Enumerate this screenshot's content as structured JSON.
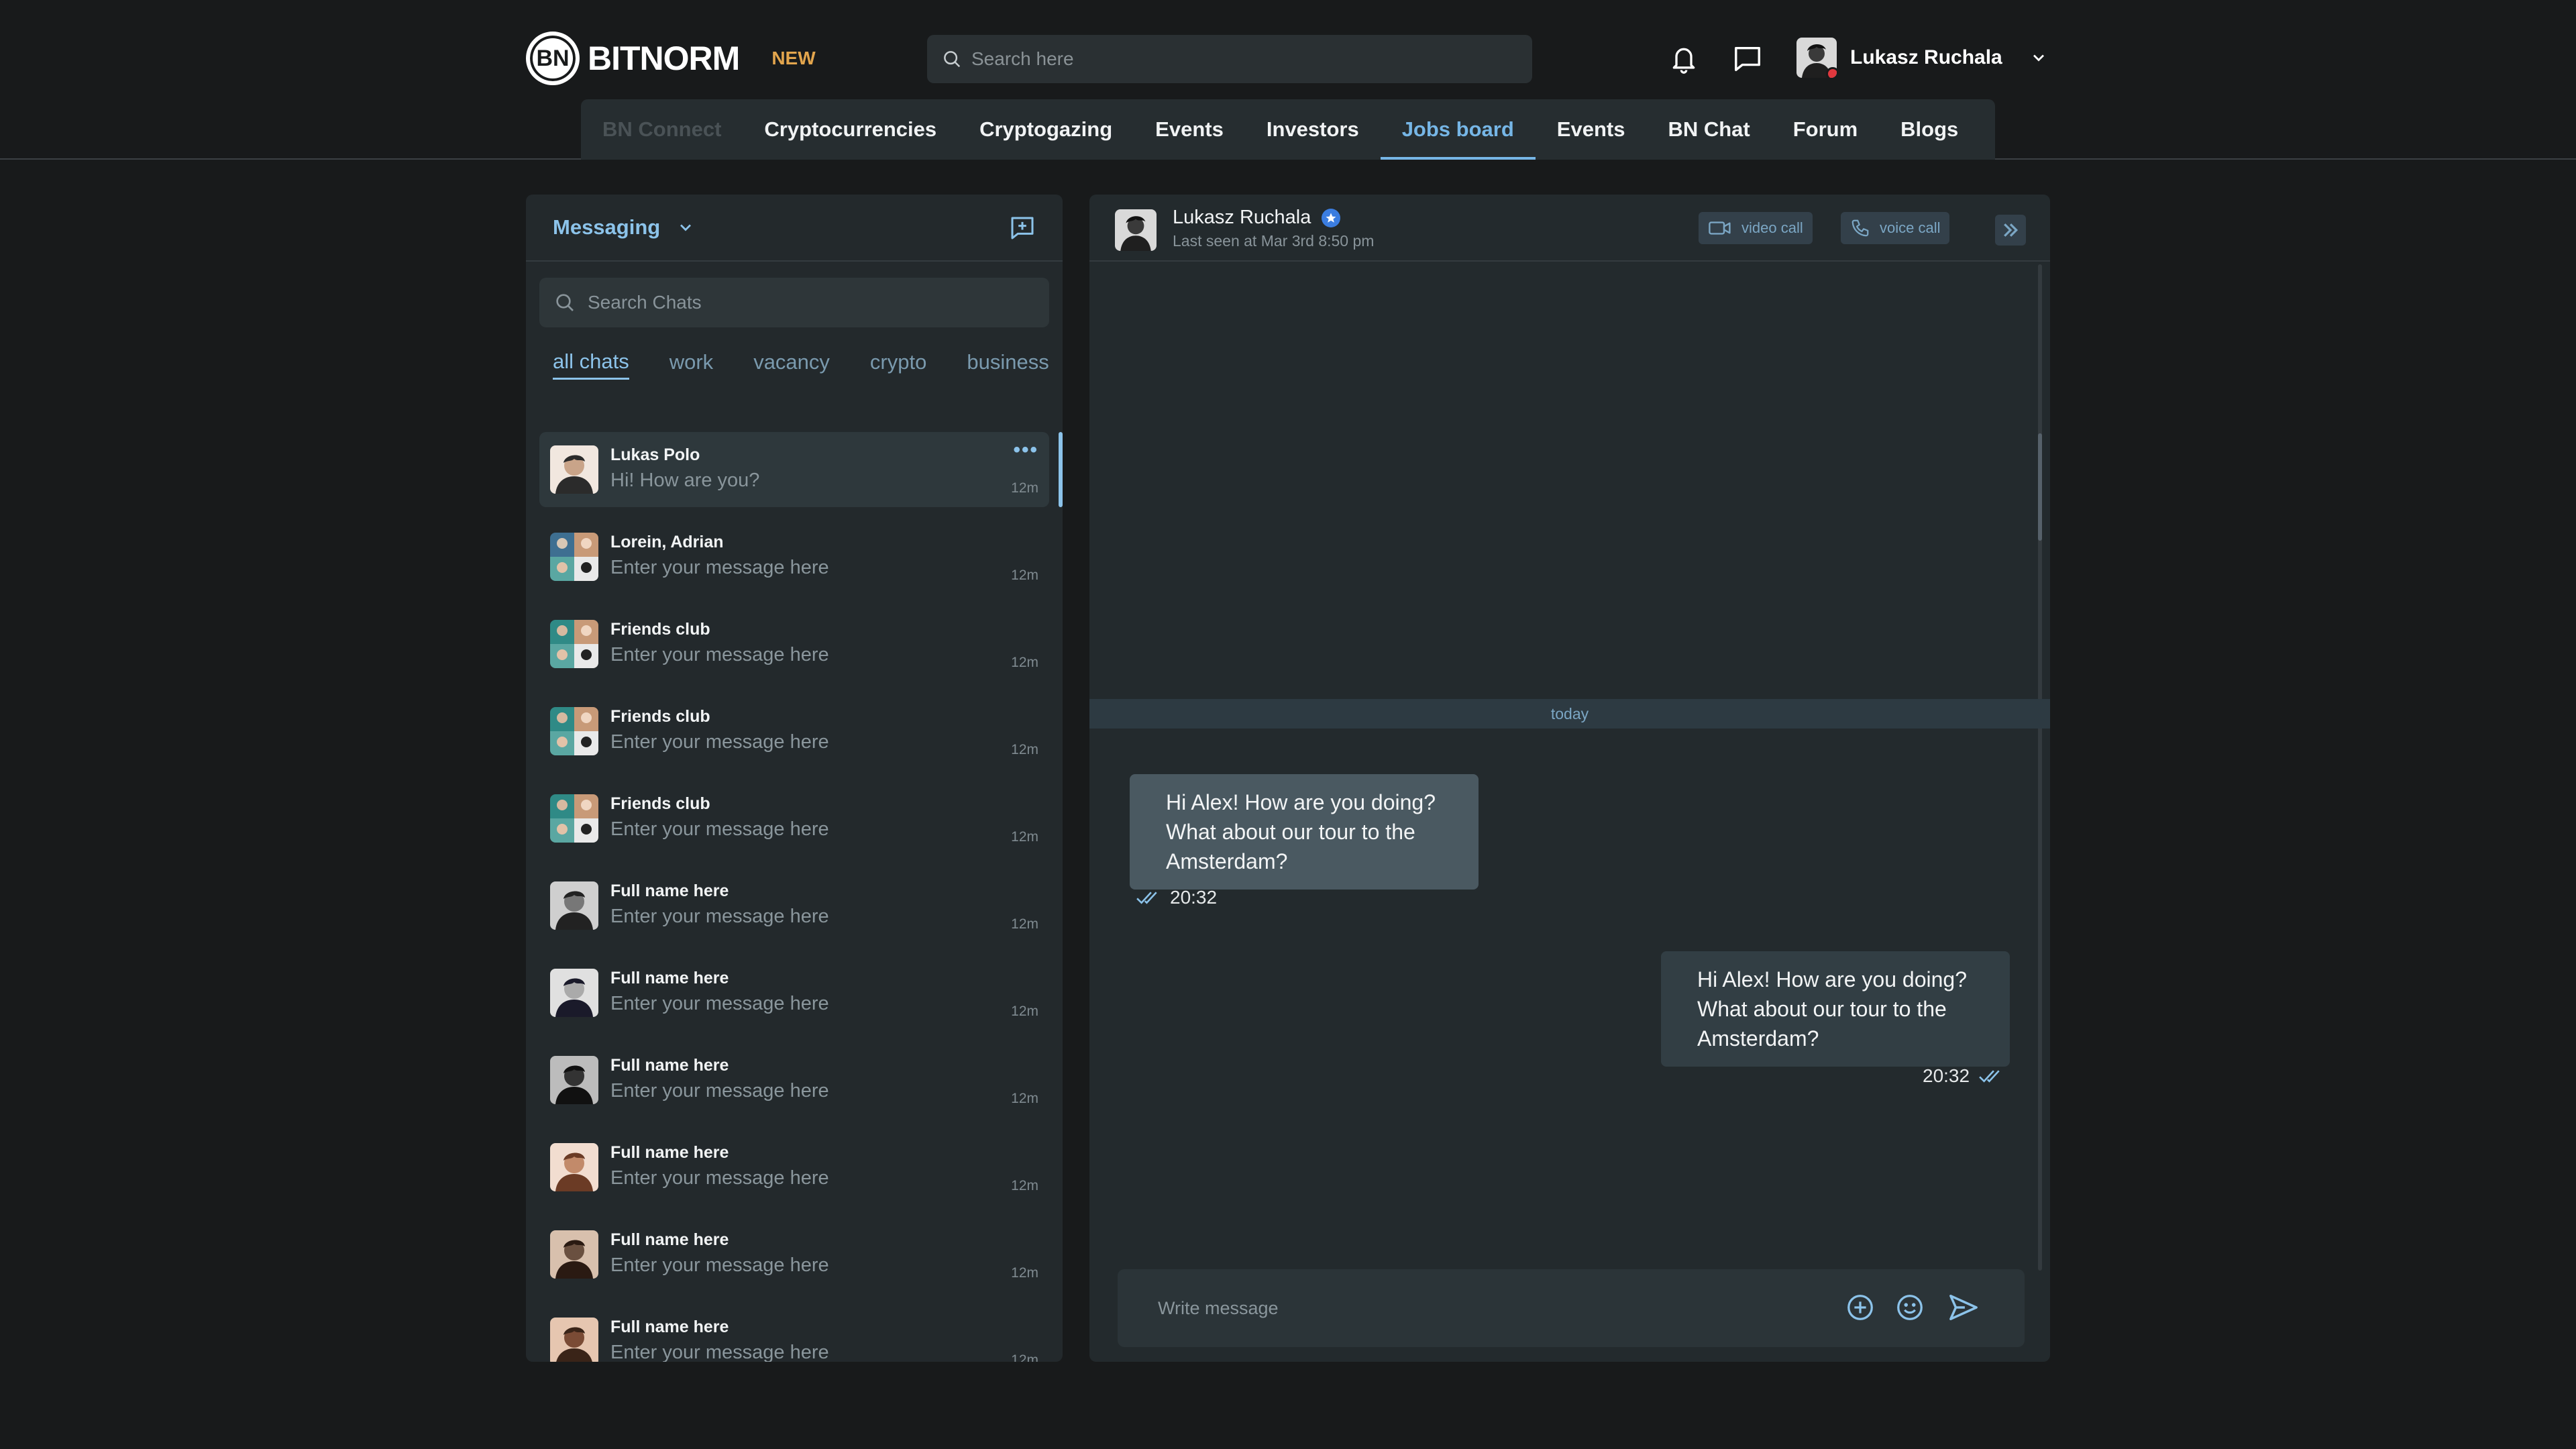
{
  "header": {
    "logo_mark": "BN",
    "brand": "BITNORM",
    "badge": "NEW",
    "search_placeholder": "Search here",
    "user_name": "Lukasz Ruchala"
  },
  "nav": [
    {
      "label": "BN Connect",
      "state": "disabled"
    },
    {
      "label": "Cryptocurrencies",
      "state": "normal"
    },
    {
      "label": "Cryptogazing",
      "state": "normal"
    },
    {
      "label": "Events",
      "state": "normal"
    },
    {
      "label": "Investors",
      "state": "normal"
    },
    {
      "label": "Jobs board",
      "state": "active"
    },
    {
      "label": "Events",
      "state": "normal"
    },
    {
      "label": "BN Chat",
      "state": "normal"
    },
    {
      "label": "Forum",
      "state": "normal"
    },
    {
      "label": "Blogs",
      "state": "normal"
    }
  ],
  "messaging": {
    "title": "Messaging",
    "search_placeholder": "Search Chats",
    "filters": [
      "all chats",
      "work",
      "vacancy",
      "crypto",
      "business"
    ],
    "chats": [
      {
        "name": "Lukas Polo",
        "message": "Hi! How are you?",
        "time": "12m",
        "active": true
      },
      {
        "name": "Lorein, Adrian",
        "message": "Enter your message here",
        "time": "12m"
      },
      {
        "name": "Friends club",
        "message": "Enter your message here",
        "time": "12m"
      },
      {
        "name": "Friends club",
        "message": "Enter your message here",
        "time": "12m"
      },
      {
        "name": "Friends club",
        "message": "Enter your message here",
        "time": "12m"
      },
      {
        "name": "Full name here",
        "message": "Enter your message here",
        "time": "12m"
      },
      {
        "name": "Full name here",
        "message": "Enter your message here",
        "time": "12m"
      },
      {
        "name": "Full name here",
        "message": "Enter your message here",
        "time": "12m"
      },
      {
        "name": "Full name here",
        "message": "Enter your message here",
        "time": "12m"
      },
      {
        "name": "Full name here",
        "message": "Enter your message here",
        "time": "12m"
      },
      {
        "name": "Full name here",
        "message": "Enter your message here",
        "time": "12m"
      }
    ]
  },
  "conversation": {
    "contact_name": "Lukasz Ruchala",
    "last_seen": "Last seen at Mar 3rd 8:50 pm",
    "video_call": "video call",
    "voice_call": "voice call",
    "divider": "today",
    "incoming": {
      "text": "Hi Alex! How are you doing? What about our tour to the Amsterdam?",
      "time": "20:32"
    },
    "outgoing": {
      "text": "Hi Alex! How are you doing? What about our tour to the Amsterdam?",
      "time": "20:32"
    },
    "composer_placeholder": "Write message"
  },
  "colors": {
    "background": "#181a1b",
    "panel": "#23292c",
    "accent": "#8cc3ea",
    "badge": "#e2a54d",
    "status": "#e0383e"
  }
}
